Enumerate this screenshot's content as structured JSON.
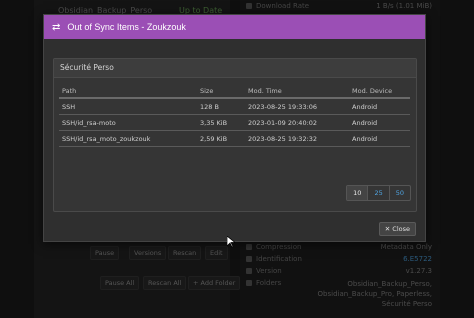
{
  "background": {
    "left_panel": {
      "folder_name": "Obsidian_Backup_Perso",
      "folder_status": "Up to Date",
      "buttons": [
        "Pause",
        "Versions",
        "Rescan",
        "Edit"
      ],
      "bottom_buttons": [
        "Pause All",
        "Rescan All",
        "+ Add Folder"
      ]
    },
    "right_panel": {
      "top_label": "Download Rate",
      "top_value": "1 B/s (1.01 MiB)",
      "rows": [
        {
          "label": "Compression",
          "value": "Metadata Only"
        },
        {
          "label": "Identification",
          "value": "6.E5722"
        },
        {
          "label": "Version",
          "value": "v1.27.3"
        },
        {
          "label": "Folders",
          "value": "Obsidian_Backup_Perso, Obsidian_Backup_Pro, Paperless, Sécurité Perso"
        }
      ]
    }
  },
  "modal": {
    "title": "Out of Sync Items - Zoukzouk",
    "panel_title": "Sécurité Perso",
    "columns": [
      "Path",
      "Size",
      "Mod. Time",
      "Mod. Device"
    ],
    "rows": [
      {
        "path": "SSH",
        "size": "128 B",
        "time": "2023-08-25 19:33:06",
        "device": "Android"
      },
      {
        "path": "SSH/id_rsa-moto",
        "size": "3,35 KiB",
        "time": "2023-01-09 20:40:02",
        "device": "Android"
      },
      {
        "path": "SSH/id_rsa_moto_zoukzouk",
        "size": "2,59 KiB",
        "time": "2023-08-25 19:32:32",
        "device": "Android"
      }
    ],
    "page_sizes": [
      "10",
      "25",
      "50"
    ],
    "active_page_size": "10",
    "close_label": "Close"
  },
  "colors": {
    "header": "#9b4fb5",
    "link": "#4fa3e0"
  }
}
